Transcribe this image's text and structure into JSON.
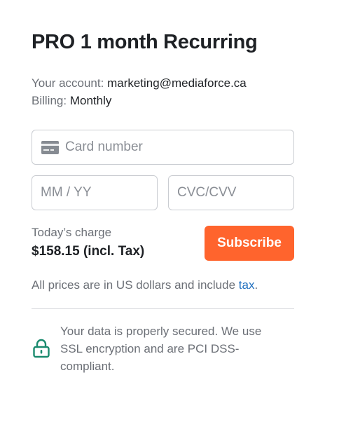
{
  "title": "PRO 1 month Recurring",
  "account": {
    "label": "Your account:",
    "value": "marketing@mediaforce.ca",
    "billing_label": "Billing:",
    "billing_value": "Monthly"
  },
  "form": {
    "card_placeholder": "Card number",
    "expiry_placeholder": "MM / YY",
    "cvc_placeholder": "CVC/CVV"
  },
  "charge": {
    "label": "Today’s charge",
    "value": "$158.15 (incl. Tax)"
  },
  "subscribe_label": "Subscribe",
  "note": {
    "text": "All prices are in US dollars and include ",
    "link": "tax",
    "end": "."
  },
  "security_text": "Your data is properly secured. We use SSL encryption and are PCI DSS-compliant.",
  "colors": {
    "accent": "#ff642d",
    "link": "#1f6fbf",
    "lock": "#1a8a6e"
  },
  "icons": [
    "credit-card-icon",
    "lock-icon"
  ]
}
